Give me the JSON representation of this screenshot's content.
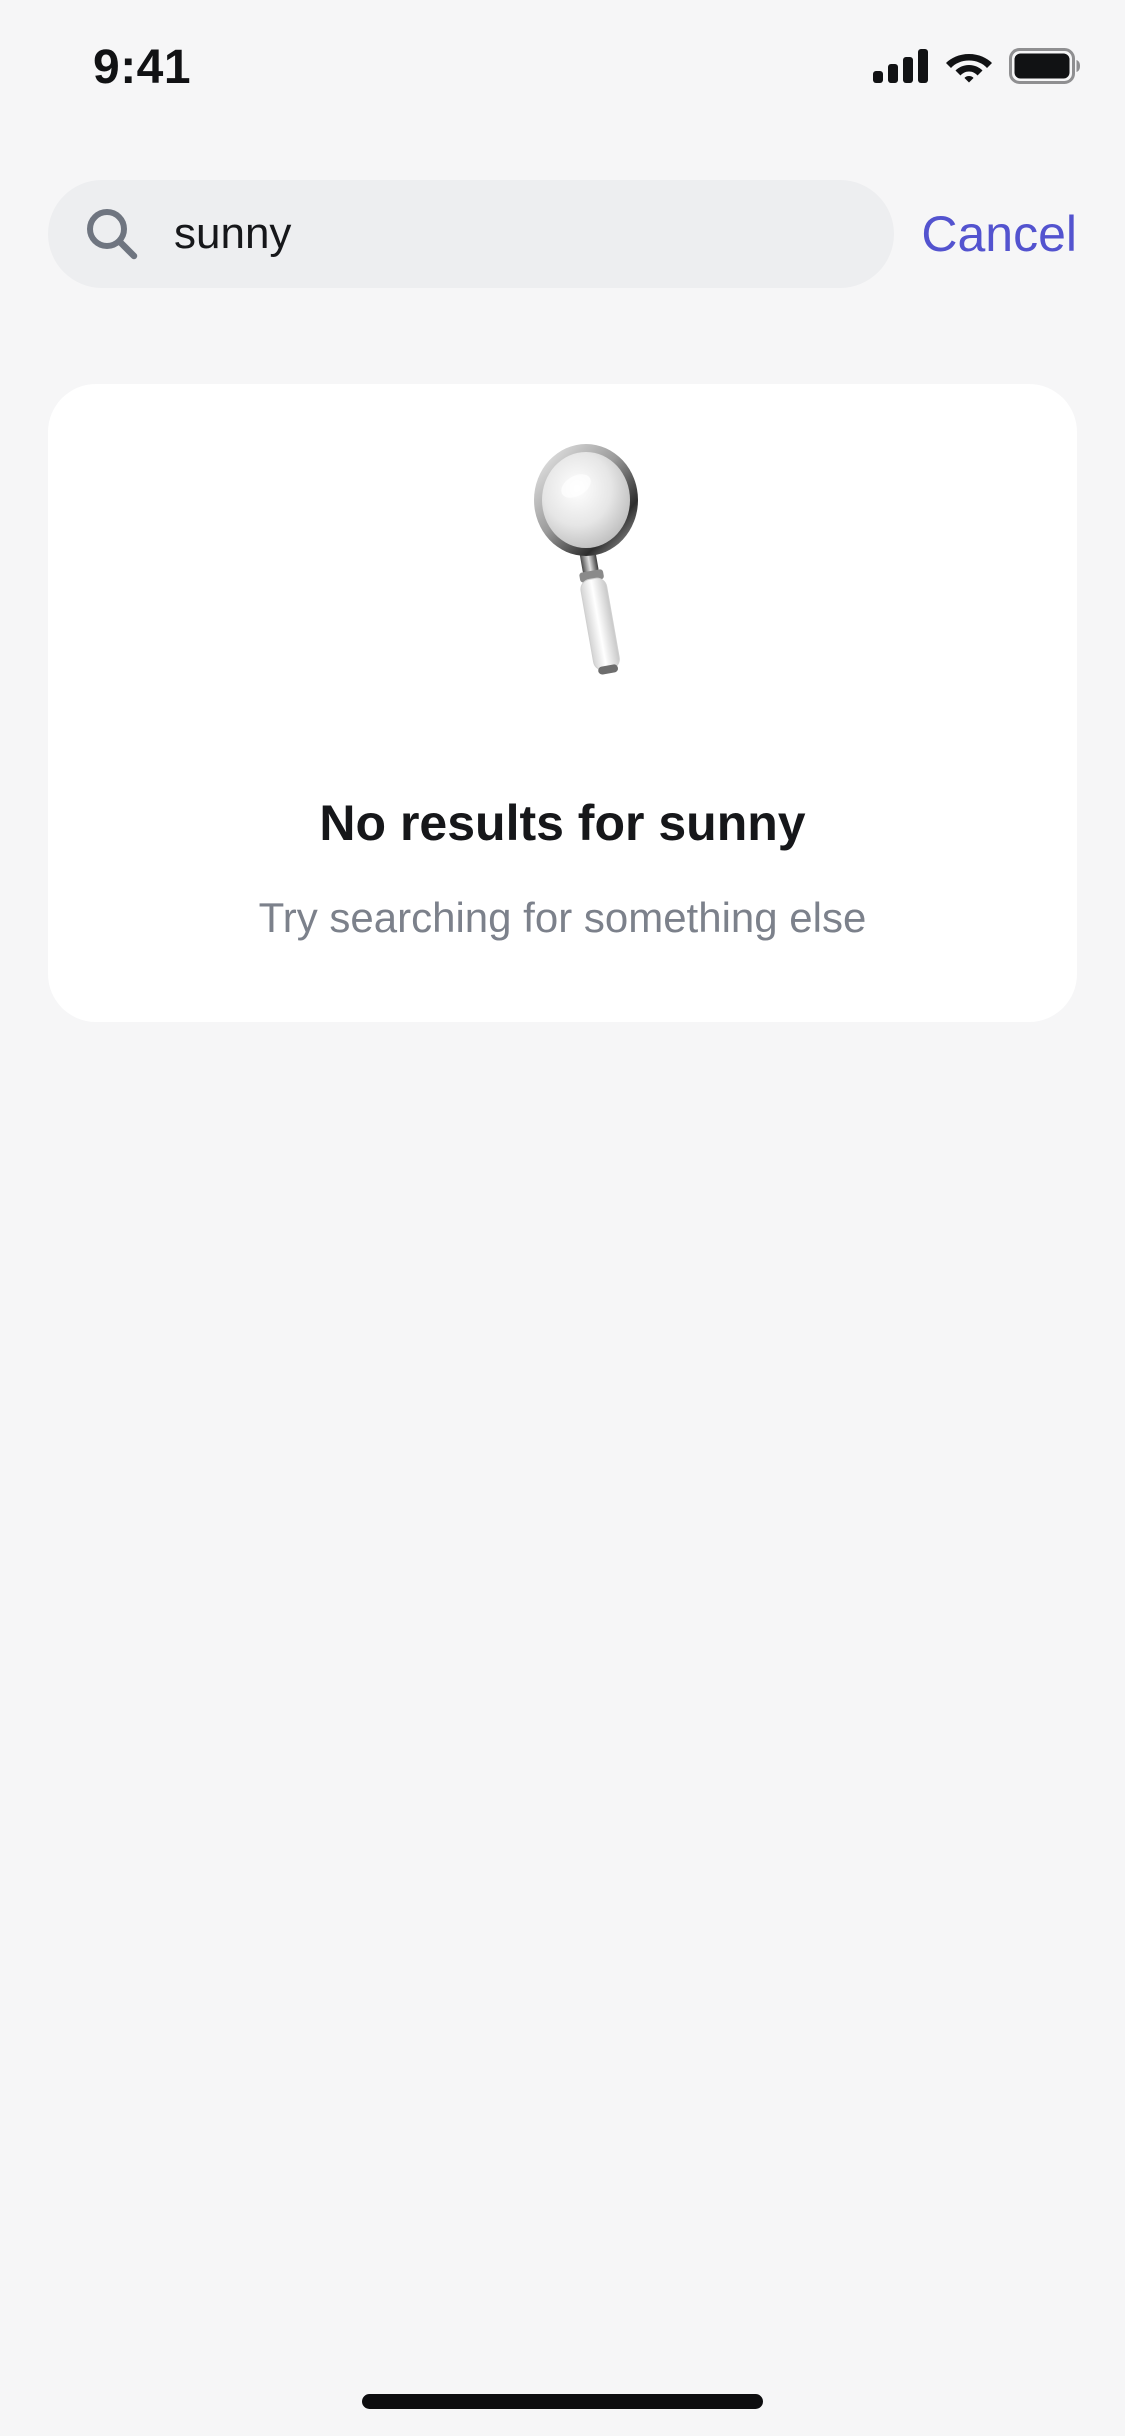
{
  "status_bar": {
    "time": "9:41",
    "icons": [
      "cellular-signal-icon",
      "wifi-icon",
      "battery-icon"
    ]
  },
  "search": {
    "value": "sunny",
    "cancel_label": "Cancel",
    "icon": "search-icon"
  },
  "empty_state": {
    "illustration": "magnifying-glass-illustration",
    "title": "No results for sunny",
    "subtitle": "Try searching for something else"
  },
  "colors": {
    "background": "#f6f6f7",
    "search_field": "#edeef0",
    "accent": "#5353cf",
    "card": "#ffffff",
    "subtitle": "#7c818b"
  }
}
